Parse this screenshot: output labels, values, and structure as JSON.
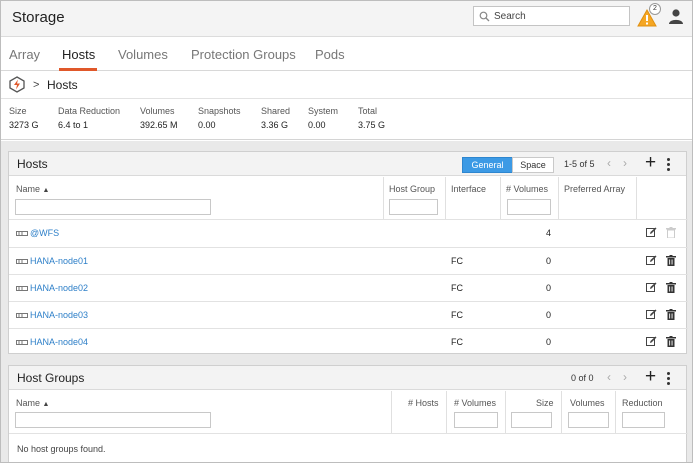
{
  "app": {
    "title": "Storage",
    "search_placeholder": "Search",
    "alert_count": "2"
  },
  "tabs": [
    {
      "label": "Array"
    },
    {
      "label": "Hosts"
    },
    {
      "label": "Volumes"
    },
    {
      "label": "Protection Groups"
    },
    {
      "label": "Pods"
    }
  ],
  "breadcrumb": {
    "separator": ">",
    "current": "Hosts"
  },
  "stats": [
    {
      "label": "Size",
      "value": "3273 G"
    },
    {
      "label": "Data Reduction",
      "value": "6.4 to 1"
    },
    {
      "label": "Volumes",
      "value": "392.65 M"
    },
    {
      "label": "Snapshots",
      "value": "0.00"
    },
    {
      "label": "Shared",
      "value": "3.36 G"
    },
    {
      "label": "System",
      "value": "0.00"
    },
    {
      "label": "Total",
      "value": "3.75 G"
    }
  ],
  "hosts_panel": {
    "title": "Hosts",
    "toggle_general": "General",
    "toggle_space": "Space",
    "pager": "1-5 of 5",
    "columns": {
      "name": "Name",
      "host_group": "Host Group",
      "interface": "Interface",
      "volumes": "# Volumes",
      "preferred_array": "Preferred Array"
    },
    "rows": [
      {
        "name": "@WFS",
        "host_group": "",
        "interface": "",
        "volumes": "4"
      },
      {
        "name": "HANA-node01",
        "host_group": "",
        "interface": "FC",
        "volumes": "0"
      },
      {
        "name": "HANA-node02",
        "host_group": "",
        "interface": "FC",
        "volumes": "0"
      },
      {
        "name": "HANA-node03",
        "host_group": "",
        "interface": "FC",
        "volumes": "0"
      },
      {
        "name": "HANA-node04",
        "host_group": "",
        "interface": "FC",
        "volumes": "0"
      }
    ]
  },
  "host_groups_panel": {
    "title": "Host Groups",
    "pager": "0 of 0",
    "columns": {
      "name": "Name",
      "hosts": "# Hosts",
      "volumes": "# Volumes",
      "size": "Size",
      "volumes2": "Volumes",
      "reduction": "Reduction"
    },
    "empty_message": "No host groups found."
  },
  "colors": {
    "accent": "#e0582a",
    "link": "#2d7fc8",
    "toggle_on": "#3c9ae5",
    "warning": "#f5a623"
  }
}
